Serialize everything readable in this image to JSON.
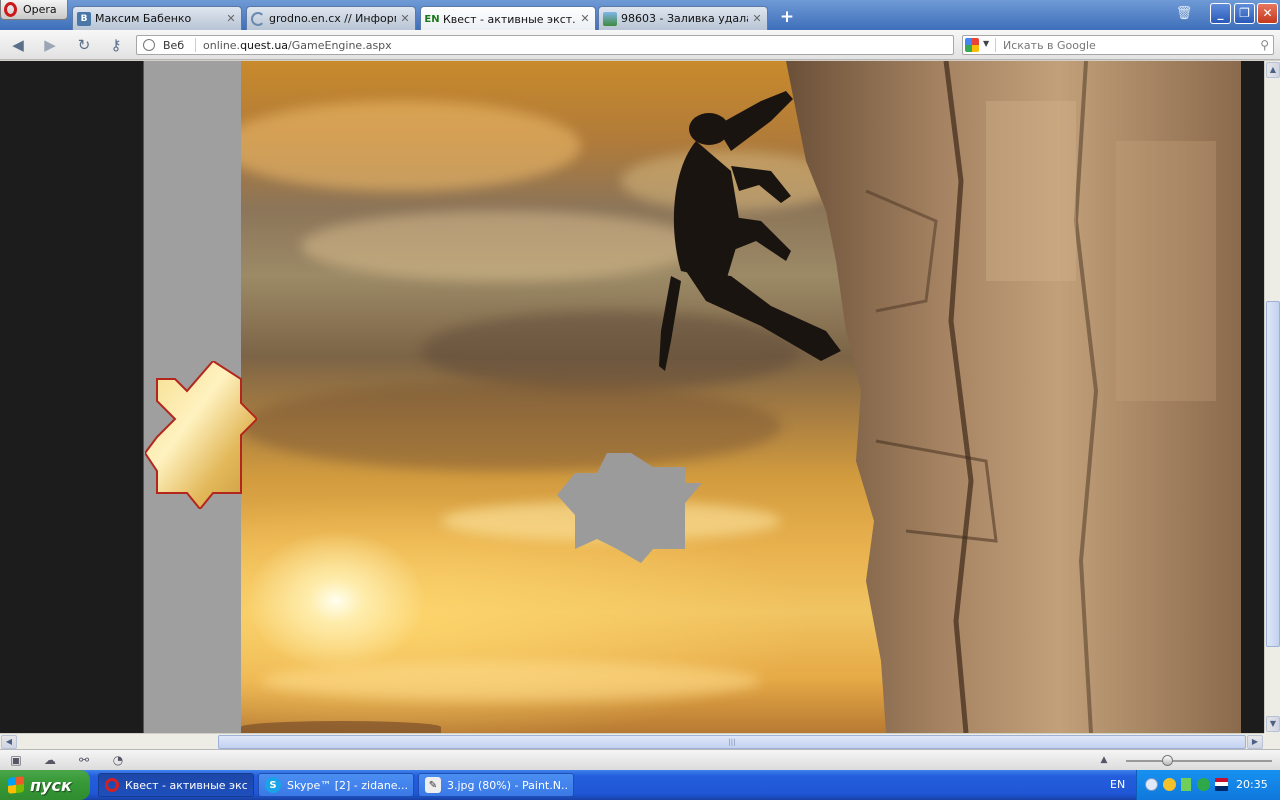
{
  "browser": {
    "menu_label": "Opera",
    "tabs": [
      {
        "title": "Максим Бабенко",
        "icon": "vk-icon"
      },
      {
        "title": "grodno.en.cx // Информ...",
        "icon": "loading-icon"
      },
      {
        "title": "Квест - активные экст...",
        "icon": "en-icon"
      },
      {
        "title": "98603 - Заливка удала...",
        "icon": "image-host-icon"
      }
    ],
    "address": {
      "site_label": "Веб",
      "url_prefix": "online.",
      "url_domain": "quest.ua",
      "url_path": "/GameEngine.aspx"
    },
    "search": {
      "placeholder": "Искать в Google",
      "engine_icon": "google-icon"
    }
  },
  "page": {
    "description_colors": {
      "sky_gold": "#e8b04d",
      "piece_left_fill": "#e9c46a",
      "piece_left_border": "#c0392b",
      "piece_gray_fill": "#9a9a9a"
    }
  },
  "taskbar": {
    "start_label": "пуск",
    "tasks": [
      {
        "label": "Квест - активные экс...",
        "icon": "opera-icon",
        "active": true
      },
      {
        "label": "Skype™ [2] - zidane....",
        "icon": "skype-icon",
        "active": false
      },
      {
        "label": "3.jpg (80%) - Paint.N...",
        "icon": "paint-icon",
        "active": false
      }
    ],
    "lang": "EN",
    "clock": "20:35"
  }
}
